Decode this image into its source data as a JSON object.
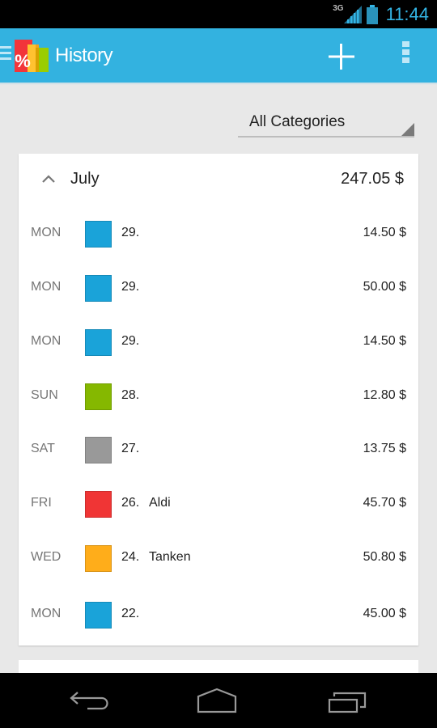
{
  "status_bar": {
    "network": "3G",
    "time": "11:44",
    "icons": [
      "signal-icon",
      "battery-icon"
    ]
  },
  "action_bar": {
    "title": "History",
    "icons": [
      "drawer-icon",
      "app-logo-icon",
      "add-icon",
      "overflow-menu-icon"
    ],
    "brand_color": "#33b2e0"
  },
  "filter": {
    "selected": "All Categories"
  },
  "month": {
    "name": "July",
    "total": "247.05 $",
    "expanded": true
  },
  "entries": [
    {
      "dow": "MON",
      "day": "29.",
      "note": "",
      "amount": "14.50 $",
      "color": "#1aa3d9"
    },
    {
      "dow": "MON",
      "day": "29.",
      "note": "",
      "amount": "50.00 $",
      "color": "#1aa3d9"
    },
    {
      "dow": "MON",
      "day": "29.",
      "note": "",
      "amount": "14.50 $",
      "color": "#1aa3d9"
    },
    {
      "dow": "SUN",
      "day": "28.",
      "note": "",
      "amount": "12.80 $",
      "color": "#85b800"
    },
    {
      "dow": "SAT",
      "day": "27.",
      "note": "",
      "amount": "13.75 $",
      "color": "#999999"
    },
    {
      "dow": "FRI",
      "day": "26.",
      "note": "Aldi",
      "amount": "45.70 $",
      "color": "#f03535"
    },
    {
      "dow": "WED",
      "day": "24.",
      "note": "Tanken",
      "amount": "50.80 $",
      "color": "#ffad1a"
    },
    {
      "dow": "MON",
      "day": "22.",
      "note": "",
      "amount": "45.00 $",
      "color": "#1aa3d9"
    }
  ],
  "nav_bar": {
    "buttons": [
      "back-icon",
      "home-icon",
      "recents-icon"
    ]
  }
}
